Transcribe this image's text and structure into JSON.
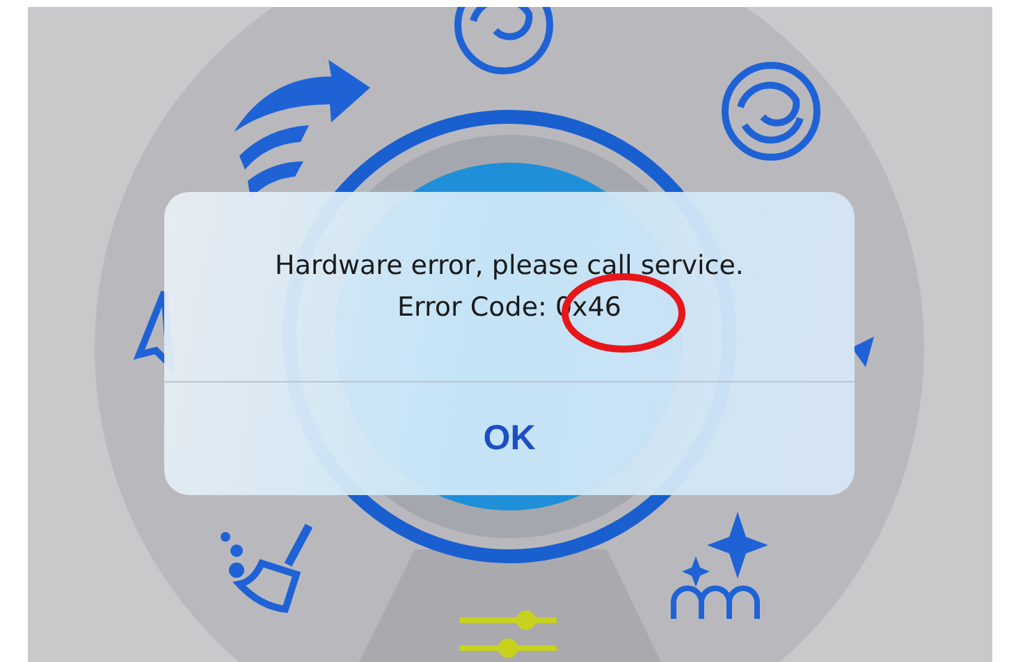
{
  "dialog": {
    "message": "Hardware error, please call service.",
    "detail": "Error Code: 0x46",
    "buttons": [
      {
        "label": "OK"
      }
    ]
  }
}
